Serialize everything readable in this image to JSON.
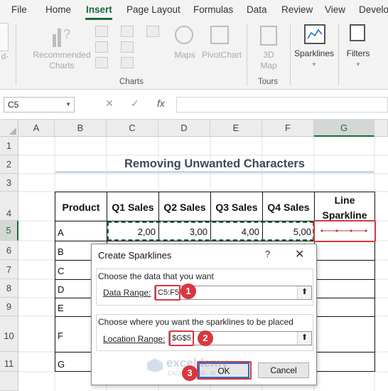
{
  "menu": [
    "File",
    "Home",
    "Insert",
    "Page Layout",
    "Formulas",
    "Data",
    "Review",
    "View",
    "Develo"
  ],
  "ribbon": {
    "recommended_charts": "Recommended Charts",
    "maps": "Maps",
    "pivotchart": "PivotChart",
    "map3d": "3D Map",
    "sparklines": "Sparklines",
    "filters": "Filters",
    "group_charts": "Charts",
    "group_tours": "Tours",
    "left_edge_text": "d-"
  },
  "formula_bar": {
    "name_box": "C5",
    "cancel": "✕",
    "enter": "✓",
    "fx": "fx",
    "value": ""
  },
  "columns": [
    "A",
    "B",
    "C",
    "D",
    "E",
    "F",
    "G"
  ],
  "rows": [
    "1",
    "2",
    "3",
    "4",
    "5",
    "6",
    "7",
    "8",
    "9",
    "10",
    "11"
  ],
  "sheet": {
    "title": "Removing Unwanted Characters",
    "headers": [
      "Product",
      "Q1 Sales",
      "Q2 Sales",
      "Q3 Sales",
      "Q4 Sales",
      "Line Sparkline"
    ],
    "products": [
      "A",
      "B",
      "C",
      "D",
      "E",
      "F",
      "G"
    ],
    "row_a_values": [
      "2,00",
      "3,00",
      "4,00",
      "5,00"
    ]
  },
  "dialog": {
    "title": "Create Sparklines",
    "help": "?",
    "close": "✕",
    "section1": "Choose the data that you want",
    "data_range_label": "Data Range:",
    "data_range_value": "C5:F5",
    "section2": "Choose where you want the sparklines to be placed",
    "location_range_label": "Location Range:",
    "location_range_value": "$G$5",
    "ok": "OK",
    "cancel": "Cancel",
    "collapse_icon": "⬆"
  },
  "markers": [
    "1",
    "2",
    "3"
  ],
  "watermark": "exceldemy",
  "watermark_sub": "EXCEL · DATA · BI",
  "colors": {
    "excel_green": "#1d6b3c",
    "highlight_red": "#d9363e",
    "title_text": "#3d4a57"
  }
}
